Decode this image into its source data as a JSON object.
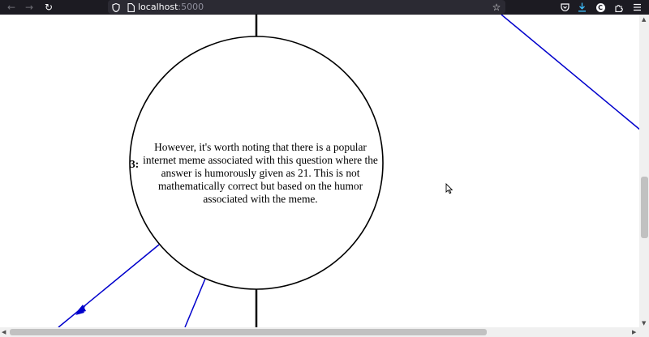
{
  "browser": {
    "url_host": "localhost",
    "url_port": ":5000",
    "icons": [
      "back-icon",
      "forward-icon",
      "reload-icon",
      "shield-icon",
      "page-icon",
      "bookmark-star-icon",
      "pocket-icon",
      "download-icon",
      "account-icon",
      "extensions-icon",
      "menu-icon"
    ]
  },
  "graph": {
    "node_number": "3:",
    "node_text": "However, it's worth noting that there is a popular internet meme associated with this question where the answer is humorously given as 21. This is not mathematically correct but based on the humor associated with the meme.",
    "edge_color": "#0000cc"
  },
  "account_initial": "C"
}
